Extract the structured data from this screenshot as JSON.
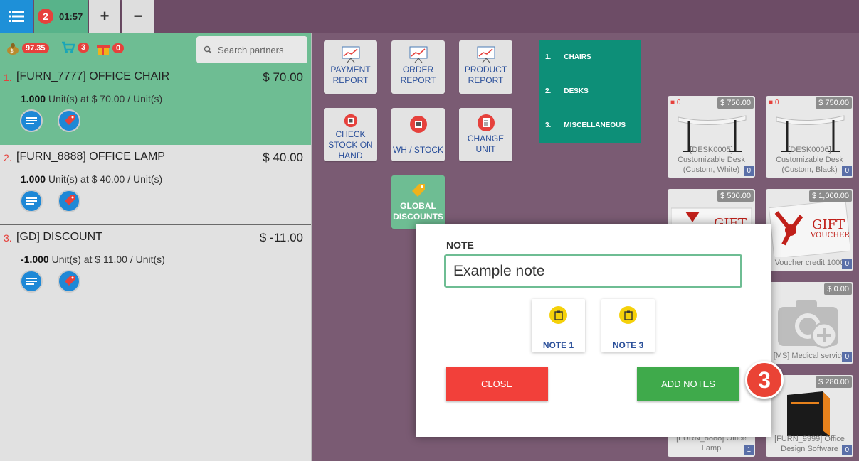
{
  "topbar": {
    "order_number": "2",
    "order_time": "01:57",
    "add_label": "+",
    "remove_label": "−"
  },
  "left_header": {
    "money_badge": "97.35",
    "cart_badge": "3",
    "gift_badge": "0",
    "search_placeholder": "Search partners"
  },
  "orderlines": [
    {
      "index": "1.",
      "name": "[FURN_7777] OFFICE CHAIR",
      "price": "$ 70.00",
      "qty": "1.000",
      "detail": " Unit(s) at $ 70.00 / Unit(s)"
    },
    {
      "index": "2.",
      "name": "[FURN_8888] OFFICE LAMP",
      "price": "$ 40.00",
      "qty": "1.000",
      "detail": " Unit(s) at $ 40.00 / Unit(s)"
    },
    {
      "index": "3.",
      "name": "[GD] DISCOUNT",
      "price": "$ -11.00",
      "qty": "-1.000",
      "detail": " Unit(s) at $ 11.00 / Unit(s)"
    }
  ],
  "controls": {
    "payment_report": [
      "PAYMENT",
      "REPORT"
    ],
    "order_report": [
      "ORDER",
      "REPORT"
    ],
    "product_report": [
      "PRODUCT",
      "REPORT"
    ],
    "check_stock": [
      "CHECK",
      "STOCK ON",
      "HAND"
    ],
    "wh_stock": [
      "WH / STOCK"
    ],
    "change_unit": [
      "CHANGE",
      "UNIT"
    ],
    "global_discounts": [
      "GLOBAL",
      "DISCOUNTS"
    ]
  },
  "categories": [
    {
      "num": "1.",
      "label": "CHAIRS"
    },
    {
      "num": "2.",
      "label": "DESKS"
    },
    {
      "num": "3.",
      "label": "MISCELLANEOUS"
    }
  ],
  "products": {
    "desk5": {
      "price": "$ 750.00",
      "lock": "0",
      "name": "[DESK0005] Customizable Desk (Custom, White)",
      "stock": "0"
    },
    "desk6": {
      "price": "$ 750.00",
      "lock": "0",
      "name": "[DESK0006] Customizable Desk (Custom, Black)",
      "stock": "0"
    },
    "gift500": {
      "price": "$ 500.00"
    },
    "gift1000": {
      "price": "$ 1,000.00",
      "name": "Voucher credit 1000",
      "stock": "0"
    },
    "medical": {
      "price": "$ 0.00",
      "name": "[MS] Medical service",
      "stock": "0"
    },
    "lamp": {
      "name": "[FURN_8888] Office Lamp",
      "stock": "1"
    },
    "software": {
      "price": "$ 280.00",
      "name": "[FURN_9999] Office Design Software",
      "stock": "0"
    }
  },
  "modal": {
    "label": "NOTE",
    "value": "Example note",
    "preset1": "NOTE 1",
    "preset3": "NOTE 3",
    "close_label": "CLOSE",
    "add_label": "ADD NOTES"
  },
  "step_badge": "3",
  "colors": {
    "accent_green": "#6ebd93",
    "accent_red": "#e6413c",
    "category_teal": "#0d8f78",
    "background": "#7a5b73"
  }
}
